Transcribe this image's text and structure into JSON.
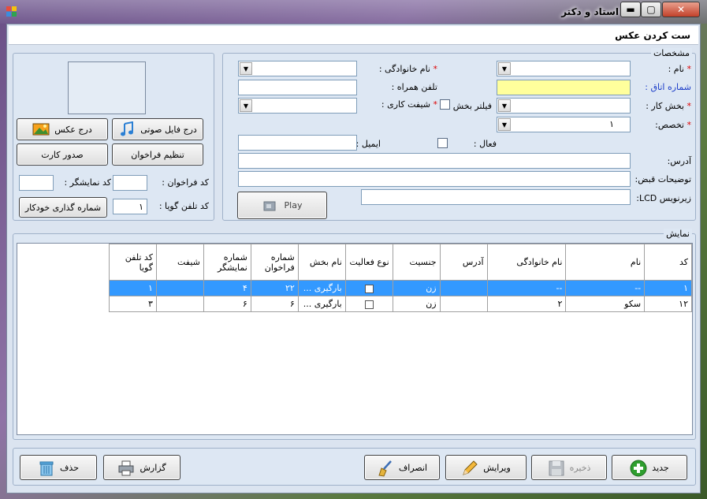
{
  "window": {
    "title": "استاد و دکتر"
  },
  "header": {
    "title": "ست کردن عکس"
  },
  "details": {
    "legend": "مشخصات",
    "name_label": "نام :",
    "family_label": "نام خانوادگی :",
    "room_label": "شماره اتاق :",
    "mobile_label": "تلفن همراه :",
    "dept_label": "بخش کار :",
    "dept_filter_label": "فیلتر بخش",
    "shift_label": "شیفت کاری :",
    "specialty_label": "تخصص:",
    "specialty_value": "۱",
    "active_label": "فعال :",
    "email_label": "ایمیل :",
    "address_label": "آدرس:",
    "receipt_label": "توضیحات قبض:",
    "lcd_label": "زیرنویس LCD:",
    "required_mark": "*",
    "play_label": "Play"
  },
  "media": {
    "insert_photo": "درج عکس",
    "insert_audio": "درج فایل صوتی",
    "issue_card": "صدور کارت",
    "call_settings": "تنظیم فراخوان",
    "display_code_label": "کد نمایشگر :",
    "call_code_label": "کد فراخوان :",
    "talk_code_label": "کد تلفن گویا :",
    "talk_code_value": "۱",
    "auto_number": "شماره گذاری خودکار"
  },
  "display": {
    "legend": "نمایش",
    "columns": [
      "کد",
      "نام",
      "نام خانوادگی",
      "آدرس",
      "جنسیت",
      "نوع فعالیت",
      "نام بخش",
      "شماره فراخوان",
      "شماره نمایشگر",
      "شیفت",
      "کد تلفن گویا"
    ],
    "rows": [
      [
        "۱",
        "--",
        "--",
        "",
        "زن",
        "",
        "بارگیری ...",
        "۲۲",
        "۴",
        "",
        "۱"
      ],
      [
        "۱۲",
        "سکو",
        "۲",
        "",
        "زن",
        "",
        "بارگیری ...",
        "۶",
        "۶",
        "",
        "۳"
      ]
    ]
  },
  "actions": {
    "new": "جدید",
    "save": "ذخیره",
    "edit": "ویرایش",
    "cancel": "انصراف",
    "report": "گزارش",
    "delete": "حذف"
  }
}
